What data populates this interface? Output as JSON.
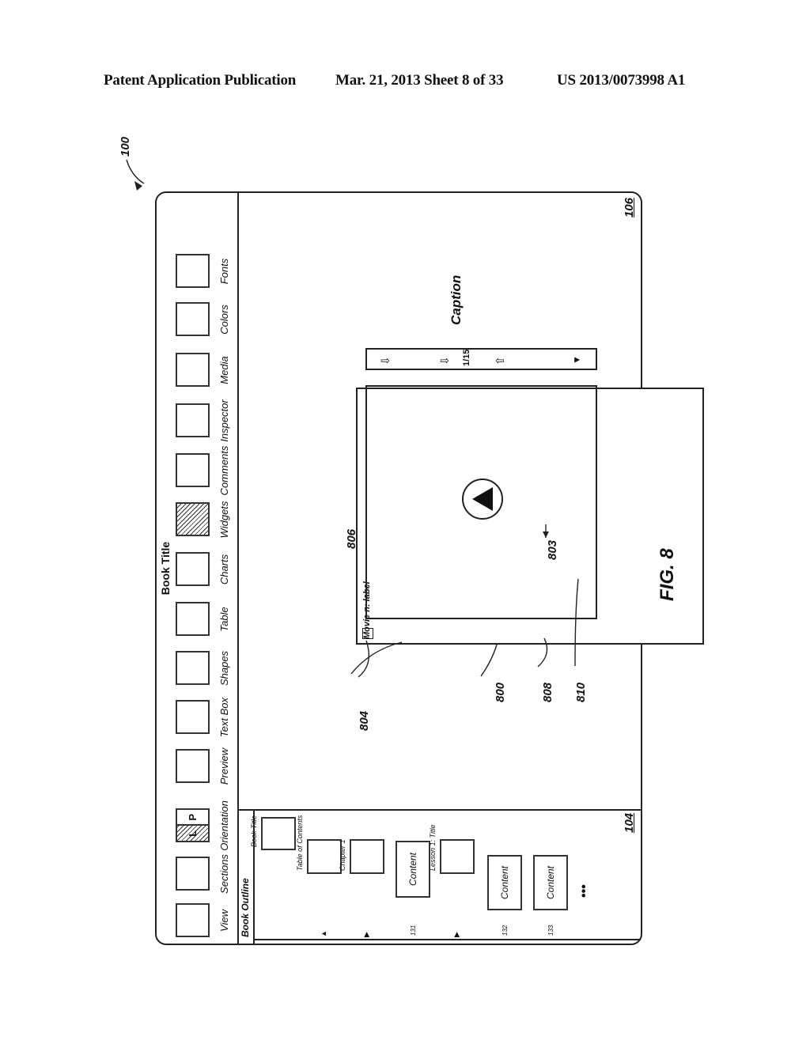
{
  "header": {
    "left": "Patent Application Publication",
    "center": "Mar. 21, 2013  Sheet 8 of 33",
    "right": "US 2013/0073998 A1"
  },
  "figure": {
    "label": "FIG. 8",
    "ref_main": "100",
    "ref_sidebar": "104",
    "ref_canvas": "106"
  },
  "app": {
    "title": "Book Title",
    "toolbar": [
      {
        "label": "View",
        "icon": "blank-square-icon",
        "state": "normal"
      },
      {
        "label": "Sections",
        "icon": "blank-square-icon",
        "state": "normal"
      },
      {
        "label": "Orientation",
        "icon": "orientation-toggle-icon",
        "state": "landscape-selected",
        "options": [
          "L",
          "P"
        ]
      },
      {
        "label": "Preview",
        "icon": "blank-square-icon",
        "state": "normal"
      },
      {
        "label": "Text Box",
        "icon": "blank-square-icon",
        "state": "normal"
      },
      {
        "label": "Shapes",
        "icon": "blank-square-icon",
        "state": "normal"
      },
      {
        "label": "Table",
        "icon": "blank-square-icon",
        "state": "normal"
      },
      {
        "label": "Charts",
        "icon": "blank-square-icon",
        "state": "normal"
      },
      {
        "label": "Widgets",
        "icon": "hatched-square-icon",
        "state": "selected"
      },
      {
        "label": "Comments",
        "icon": "blank-square-icon",
        "state": "normal"
      },
      {
        "label": "Inspector",
        "icon": "blank-square-icon",
        "state": "normal"
      },
      {
        "label": "Media",
        "icon": "blank-square-icon",
        "state": "normal"
      },
      {
        "label": "Colors",
        "icon": "blank-square-icon",
        "state": "normal"
      },
      {
        "label": "Fonts",
        "icon": "blank-square-icon",
        "state": "normal"
      }
    ],
    "sidebar": {
      "heading": "Book Outline",
      "items": [
        {
          "label": "Book Title",
          "type": "thumb"
        },
        {
          "label": "Table of Contents",
          "type": "thumb",
          "disclosure": "expanded"
        },
        {
          "label": "Chapter 1",
          "type": "thumb",
          "disclosure": "collapsed"
        },
        {
          "label": "Content",
          "type": "page",
          "ref": "131"
        },
        {
          "label": "Lesson 1: Title",
          "type": "thumb",
          "disclosure": "collapsed"
        },
        {
          "label": "Content",
          "type": "page",
          "ref": "132"
        },
        {
          "label": "Content",
          "type": "page",
          "ref": "133"
        }
      ],
      "more": "•••"
    },
    "widget": {
      "ref": "800",
      "label": "Movie n: label",
      "label_ref": "803",
      "movie_ref": "804",
      "play_ref": "806",
      "controls_ref": "808",
      "counter": "1/15",
      "caption": "Caption",
      "caption_ref": "810"
    }
  }
}
